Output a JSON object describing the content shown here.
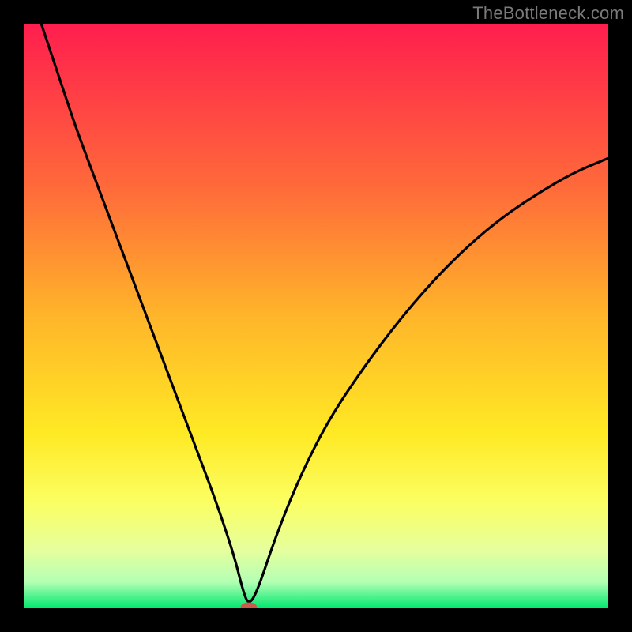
{
  "watermark": "TheBottleneck.com",
  "chart_data": {
    "type": "line",
    "title": "",
    "xlabel": "",
    "ylabel": "",
    "xlim": [
      0,
      100
    ],
    "ylim": [
      0,
      100
    ],
    "background_gradient": {
      "stops": [
        {
          "offset": 0.0,
          "color": "#ff1e4e"
        },
        {
          "offset": 0.28,
          "color": "#ff6a3a"
        },
        {
          "offset": 0.5,
          "color": "#ffb52a"
        },
        {
          "offset": 0.7,
          "color": "#ffe924"
        },
        {
          "offset": 0.82,
          "color": "#fbff63"
        },
        {
          "offset": 0.9,
          "color": "#e6ff9d"
        },
        {
          "offset": 0.955,
          "color": "#b4ffb4"
        },
        {
          "offset": 1.0,
          "color": "#00e86f"
        }
      ]
    },
    "series": [
      {
        "name": "bottleneck-curve",
        "color": "#000000",
        "x": [
          3,
          6,
          9,
          12,
          15,
          18,
          21,
          24,
          27,
          30,
          33,
          36,
          37.5,
          38.5,
          40,
          43,
          47,
          52,
          58,
          64,
          70,
          76,
          82,
          88,
          94,
          100
        ],
        "y": [
          100,
          91,
          82,
          74,
          66,
          58,
          50,
          42,
          34,
          26,
          18,
          9,
          3,
          0.5,
          3,
          12,
          22,
          32,
          41,
          49,
          56,
          62,
          67,
          71,
          74.5,
          77
        ]
      }
    ],
    "marker": {
      "name": "optimum-marker",
      "x": 38.5,
      "y": 0.2,
      "color": "#cc5a4a",
      "rx": 1.4,
      "ry": 0.8
    }
  }
}
